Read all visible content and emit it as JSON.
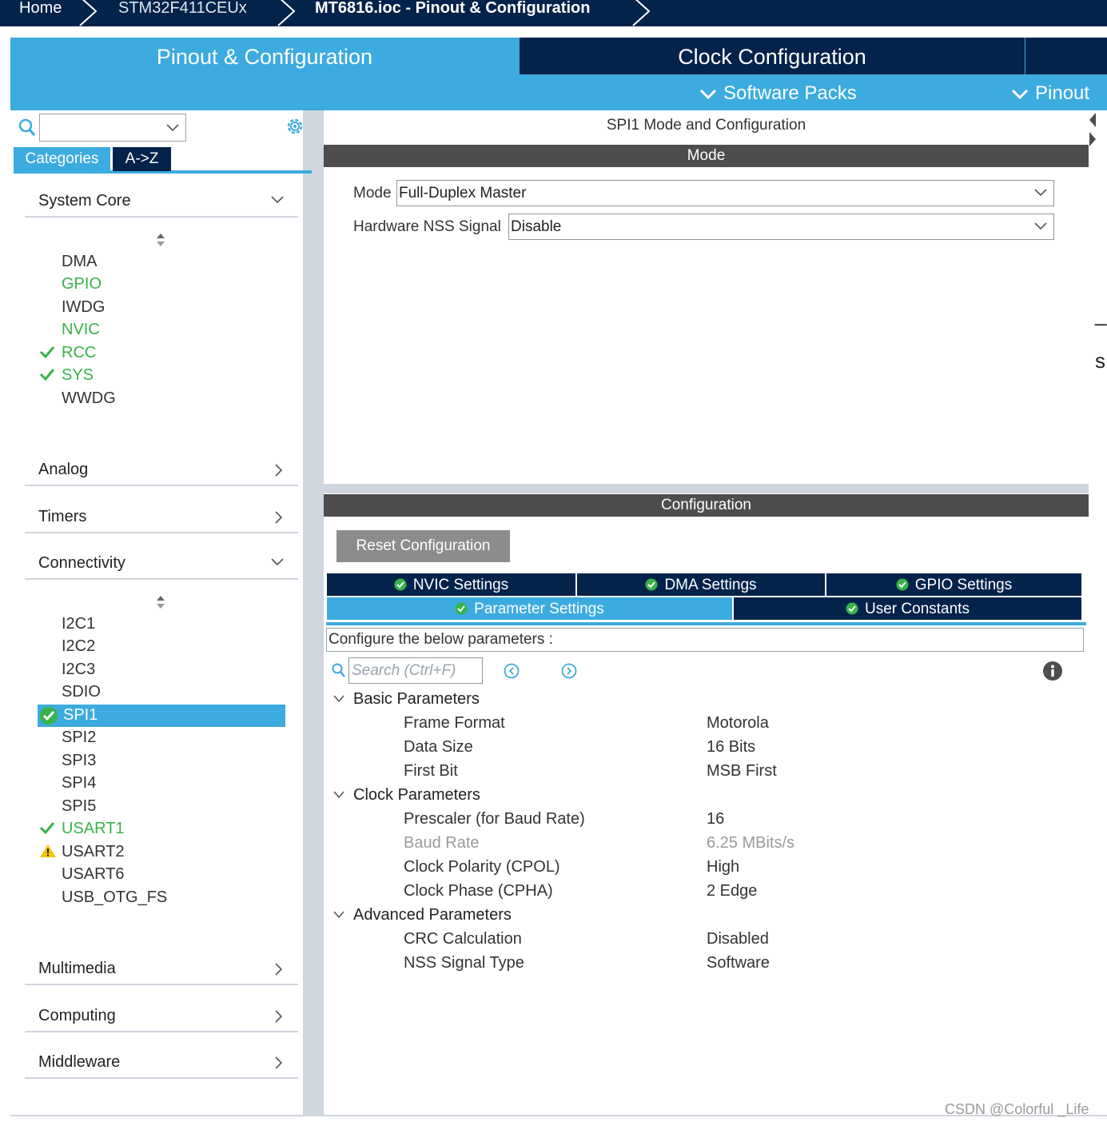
{
  "breadcrumb": [
    "Home",
    "STM32F411CEUx",
    "MT6816.ioc - Pinout & Configuration"
  ],
  "main_tabs": {
    "pinout": "Pinout & Configuration",
    "clock": "Clock Configuration",
    "software_packs": "Software Packs",
    "pinout_menu": "Pinout"
  },
  "left_panel": {
    "search_value": "",
    "tabs": [
      "Categories",
      "A->Z"
    ],
    "sections": {
      "system_core": "System Core",
      "analog": "Analog",
      "timers": "Timers",
      "connectivity": "Connectivity",
      "multimedia": "Multimedia",
      "computing": "Computing",
      "middleware": "Middleware"
    },
    "system_core_items": [
      "DMA",
      "GPIO",
      "IWDG",
      "NVIC",
      "RCC",
      "SYS",
      "WWDG"
    ],
    "connectivity_items": [
      "I2C1",
      "I2C2",
      "I2C3",
      "SDIO",
      "SPI1",
      "SPI2",
      "SPI3",
      "SPI4",
      "SPI5",
      "USART1",
      "USART2",
      "USART6",
      "USB_OTG_FS"
    ]
  },
  "mode_panel": {
    "title": "SPI1 Mode and Configuration",
    "header": "Mode",
    "mode_label": "Mode",
    "mode_value": "Full-Duplex Master",
    "nss_label": "Hardware NSS Signal",
    "nss_value": "Disable"
  },
  "config_panel": {
    "header": "Configuration",
    "reset_button": "Reset Configuration",
    "tabs_row1": [
      "NVIC Settings",
      "DMA Settings",
      "GPIO Settings"
    ],
    "tabs_row2": [
      "Parameter Settings",
      "User Constants"
    ],
    "hint": "Configure the below parameters :",
    "search_placeholder": "Search (Ctrl+F)",
    "groups": {
      "basic": "Basic Parameters",
      "clock": "Clock Parameters",
      "advanced": "Advanced Parameters"
    },
    "params": [
      {
        "name": "Frame Format",
        "value": "Motorola"
      },
      {
        "name": "Data Size",
        "value": "16 Bits"
      },
      {
        "name": "First Bit",
        "value": "MSB First"
      },
      {
        "name": "Prescaler (for Baud Rate)",
        "value": "16"
      },
      {
        "name": "Baud Rate",
        "value": "6.25 MBits/s"
      },
      {
        "name": "Clock Polarity (CPOL)",
        "value": "High"
      },
      {
        "name": "Clock Phase (CPHA)",
        "value": "2 Edge"
      },
      {
        "name": "CRC Calculation",
        "value": "Disabled"
      },
      {
        "name": "NSS Signal Type",
        "value": "Software"
      }
    ]
  },
  "edge_glyphs": [
    "_(",
    "s"
  ],
  "watermark": "CSDN @Colorful _Life",
  "colors": {
    "navy": "#03234b",
    "accent": "#3cabdf",
    "enabled_green": "#37b34a",
    "warning_yellow": "#f5c400",
    "bar_gray": "#4d4d4d"
  }
}
